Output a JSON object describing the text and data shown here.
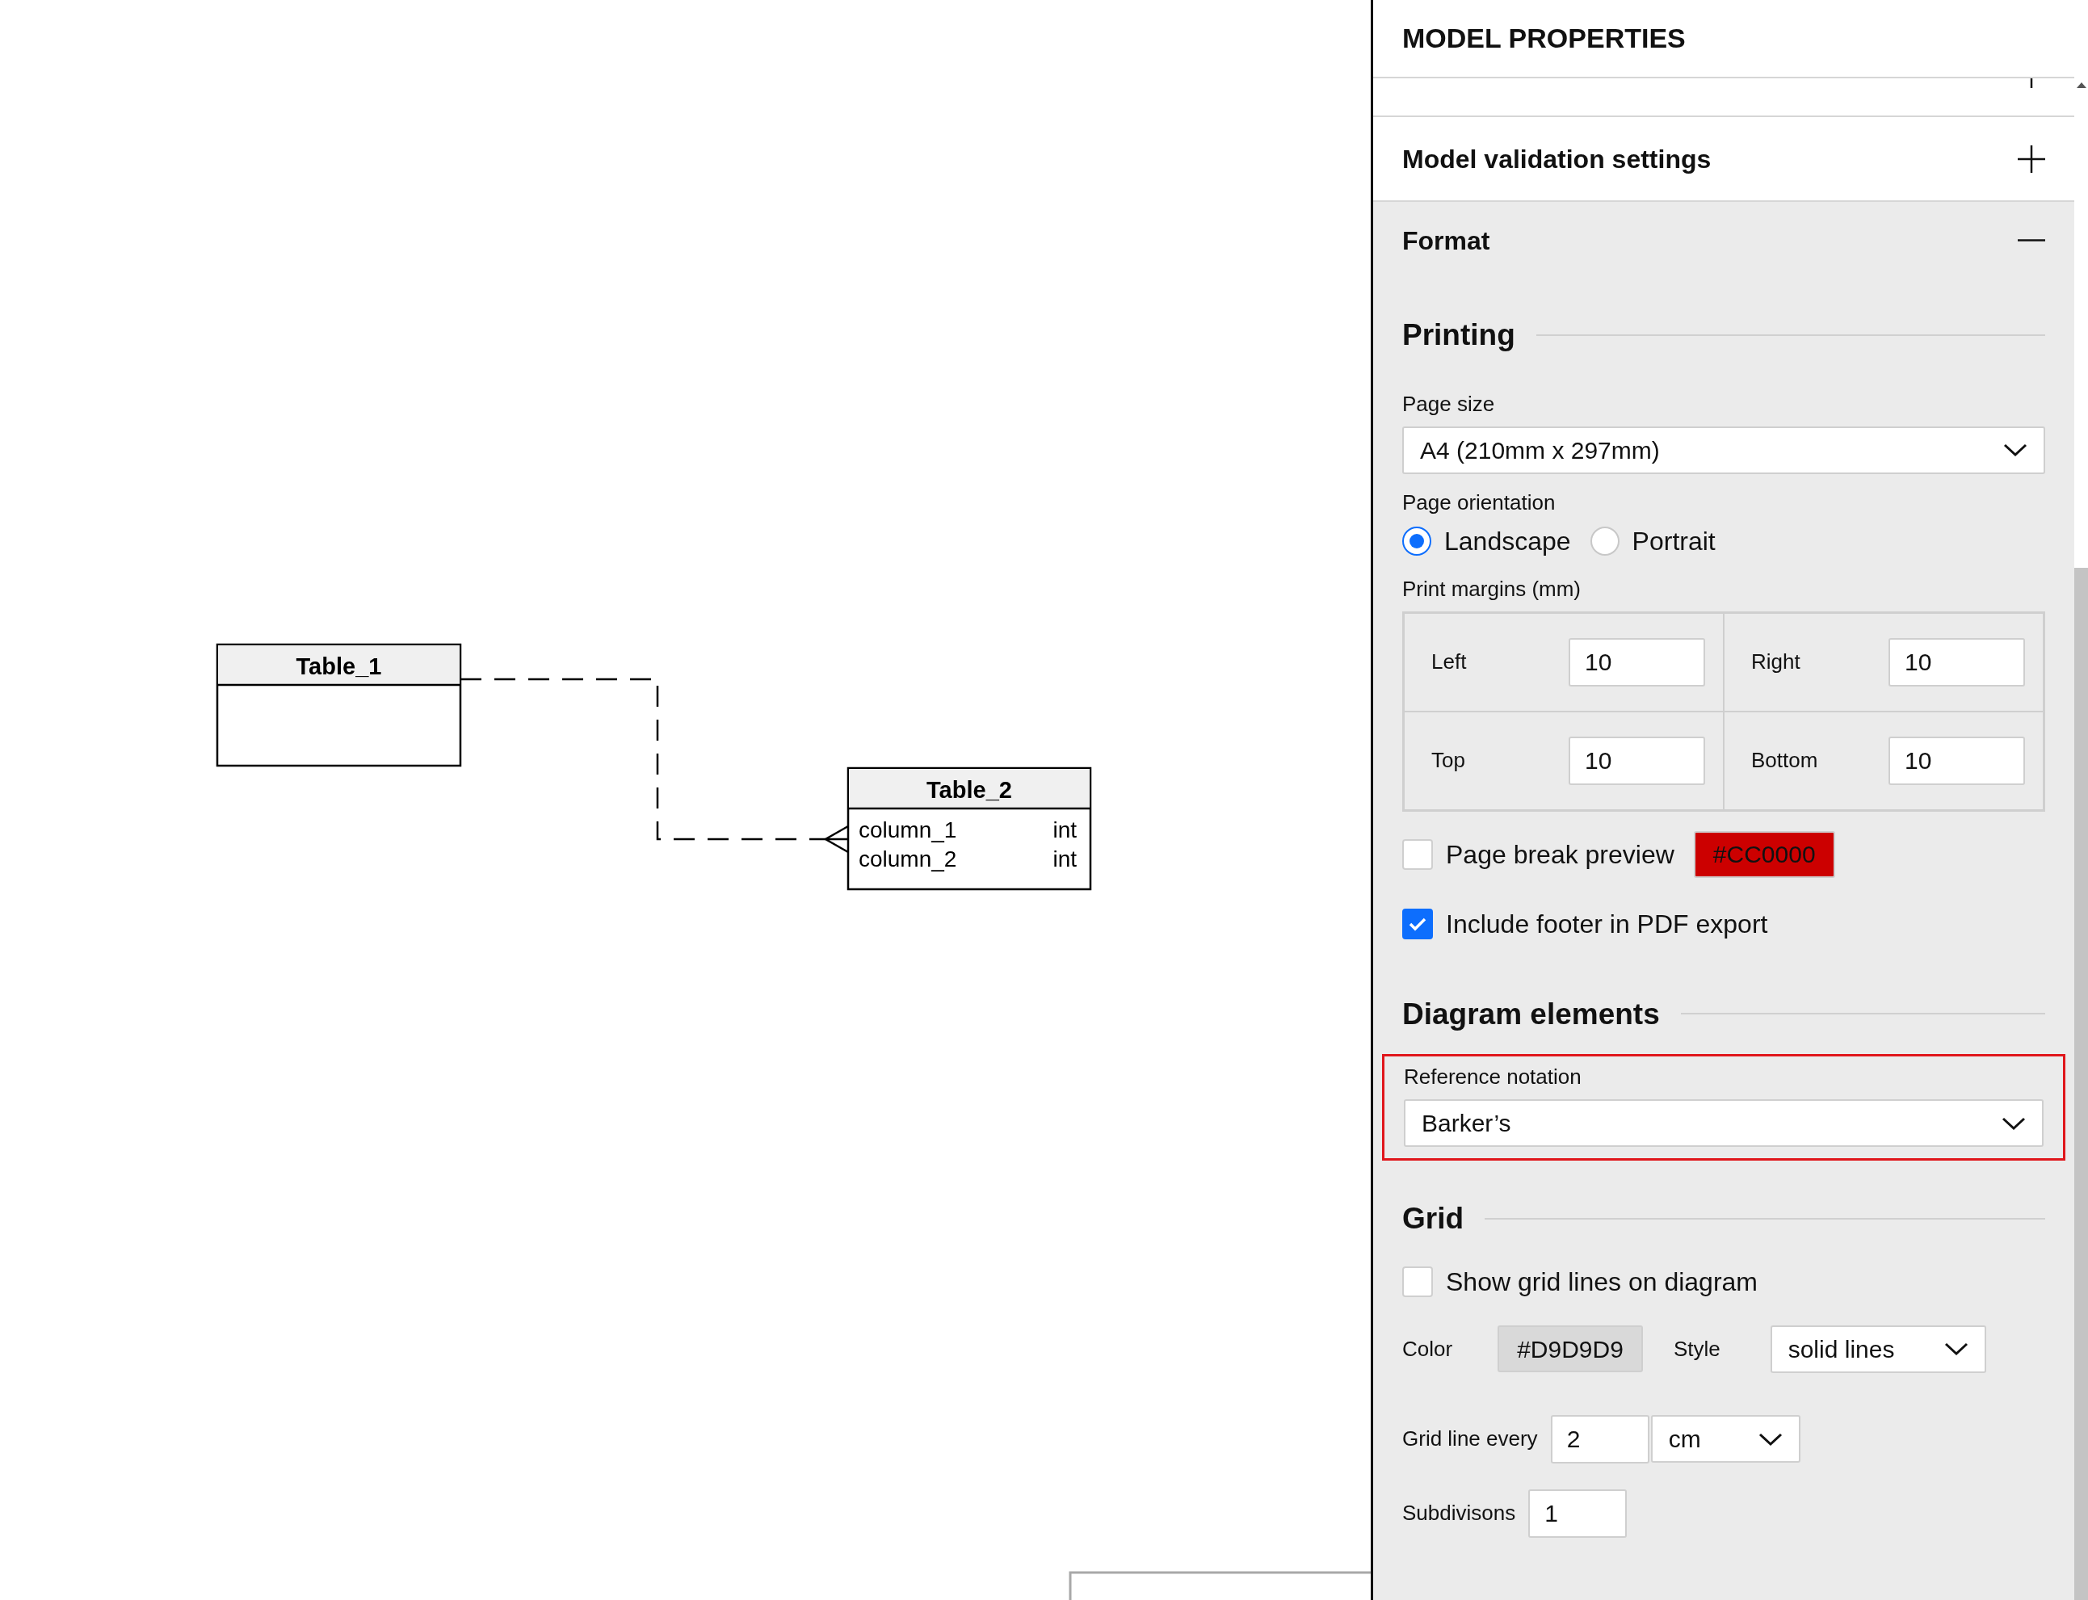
{
  "canvas": {
    "tables": [
      {
        "name": "Table_1"
      },
      {
        "name": "Table_2",
        "columns": [
          {
            "name": "column_1",
            "type": "int"
          },
          {
            "name": "column_2",
            "type": "int"
          }
        ]
      }
    ]
  },
  "panel": {
    "title": "MODEL PROPERTIES",
    "sections": [
      {
        "expanded": false
      },
      {
        "title": "Model validation settings",
        "expanded": false
      },
      {
        "title": "Format",
        "expanded": true
      }
    ]
  },
  "format": {
    "printing": {
      "heading": "Printing",
      "page_size_label": "Page size",
      "page_size": "A4 (210mm x 297mm)",
      "orientation_label": "Page orientation",
      "orientations": [
        {
          "label": "Landscape",
          "selected": true
        },
        {
          "label": "Portrait",
          "selected": false
        }
      ],
      "margins_label": "Print margins (mm)",
      "margins": [
        {
          "label": "Left",
          "value": "10"
        },
        {
          "label": "Right",
          "value": "10"
        },
        {
          "label": "Top",
          "value": "10"
        },
        {
          "label": "Bottom",
          "value": "10"
        }
      ],
      "page_break": {
        "label": "Page break preview",
        "checked": false,
        "swatch": "#CC0000",
        "color": "#cc0000"
      },
      "footer": {
        "label": "Include footer in PDF export",
        "checked": true
      }
    },
    "diagram_elements": {
      "heading": "Diagram elements",
      "notation_label": "Reference notation",
      "notation": "Barker’s",
      "highlighted": true
    },
    "grid": {
      "heading": "Grid",
      "show_lines": {
        "label": "Show grid lines on diagram",
        "checked": false
      },
      "color_label": "Color",
      "swatch": "#D9D9D9",
      "color": "#d9d9d9",
      "style_label": "Style",
      "style": "solid lines",
      "every_label": "Grid line every",
      "every": "2",
      "unit": "cm",
      "subdivisions_label": "Subdivisons",
      "subdivisions": "1"
    }
  }
}
